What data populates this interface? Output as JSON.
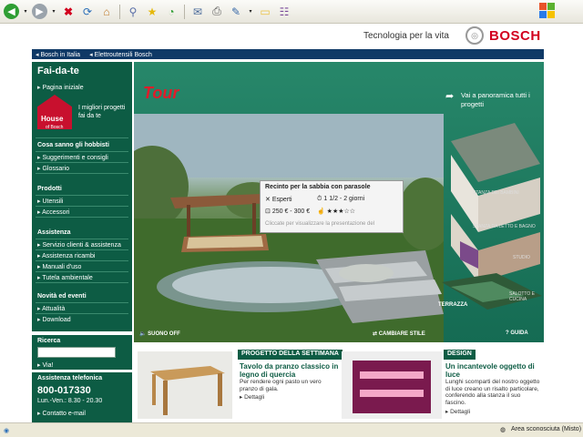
{
  "toolbar": {
    "buttons": [
      "back-button",
      "forward-button",
      "stop-button",
      "refresh-button",
      "home-button",
      "search-button",
      "favorites-button",
      "history-button",
      "mail-button",
      "print-button",
      "edit-button",
      "discuss-button",
      "messenger-button"
    ]
  },
  "header": {
    "tagline": "Tecnologia per la vita",
    "brand": "BOSCH",
    "nav": [
      "Bosch in Italia",
      "Elettroutensili Bosch"
    ]
  },
  "sidebar": {
    "title": "Fai-da-te",
    "home_link": "Pagina iniziale",
    "house_label": "House",
    "house_sub": "of Bosch",
    "promo": "I migliori progetti fai da te",
    "section1_title": "Cosa sanno gli hobbisti",
    "section1_items": [
      "Suggerimenti e consigli",
      "Glossario"
    ],
    "section2_title": "Prodotti",
    "section2_items": [
      "Utensili",
      "Accessori"
    ],
    "section3_title": "Assistenza",
    "section3_items": [
      "Servizio clienti & assistenza",
      "Assistenza ricambi",
      "Manuali d'uso",
      "Tutela ambientale"
    ],
    "section4_title": "Novità ed eventi",
    "section4_items": [
      "Attualità",
      "Download"
    ],
    "search_title": "Ricerca",
    "search_value": "",
    "search_go": "Via!",
    "phone_title": "Assistenza telefonica",
    "phone_number": "800-017330",
    "phone_hours": "Lun.-Ven.: 8.30 - 20.30",
    "contact": "Contatto e-mail"
  },
  "main": {
    "tour_label": "Tour",
    "panorama_link": "Vai a panoramica tutti i progetti",
    "popup": {
      "title": "Recinto per la sabbia con parasole",
      "level": "Esperti",
      "time": "1 1/2 - 2 giorni",
      "cost": "250 € - 300 €",
      "rating": "★★★☆☆",
      "hint": "Cliccate per visualizzare la presentazione del"
    },
    "sound_off": "SUONO OFF",
    "change_style": "CAMBIARE STILE",
    "guide": "GUIDA",
    "rooms": [
      "STANZA DEI BAMBINI",
      "STANZA DA LETTO E BAGNO",
      "STUDIO",
      "SALOTTO E CUCINA",
      "TERRAZZA"
    ]
  },
  "bottom": {
    "left_cat": "PROGETTO DELLA SETTIMANA",
    "left_title": "Tavolo da pranzo classico in legno di quercia",
    "left_text": "Per rendere ogni pasto un vero pranzo di gala.",
    "left_link": "Dettagli",
    "right_cat": "DESIGN",
    "right_title": "Un incantevole oggetto di luce",
    "right_text": "Lunghi scomparti del nostro oggetto di luce creano un risalto particolare, conferendo alla stanza il suo fascino.",
    "right_link": "Dettagli"
  },
  "statusbar": {
    "zone": "Area sconosciuta (Misto)"
  },
  "colors": {
    "green_dark": "#0d5c44",
    "green_main": "#1f7a5e",
    "navy": "#0f3966",
    "bosch_red": "#d2001e"
  }
}
